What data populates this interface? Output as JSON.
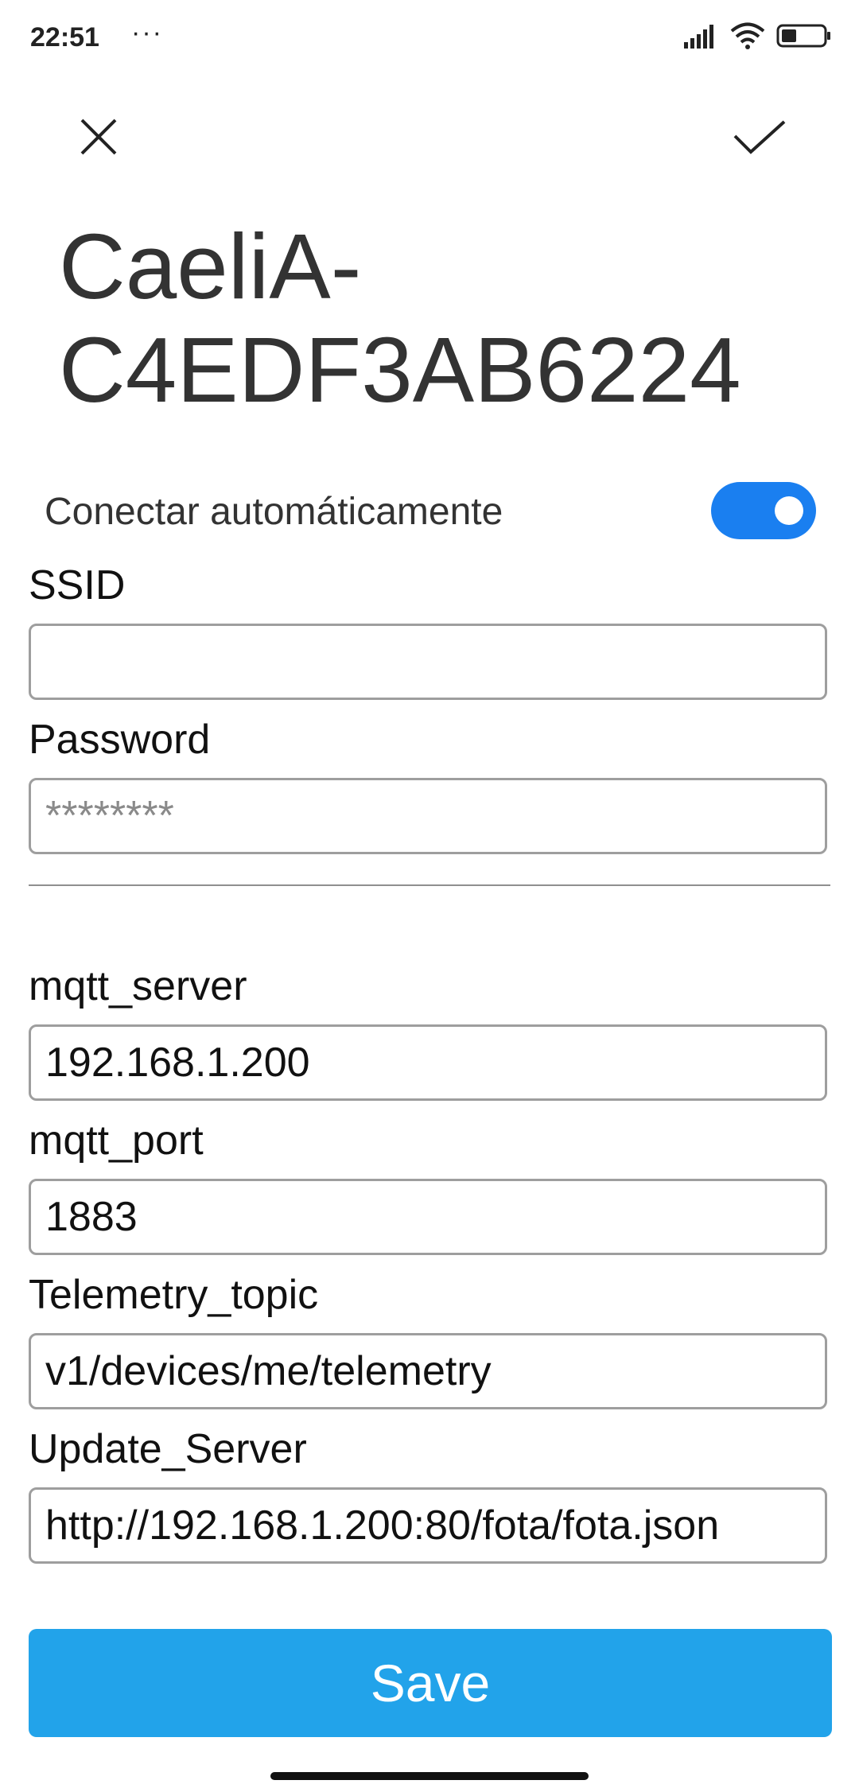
{
  "status_bar": {
    "time": "22:51",
    "notification_dots": "···",
    "icons": [
      "signal-icon",
      "wifi-icon",
      "battery-icon"
    ]
  },
  "top_bar": {
    "close_icon": "close-icon",
    "confirm_icon": "checkmark-icon"
  },
  "network": {
    "title": "CaeliA-C4EDF3AB6224"
  },
  "autoconnect": {
    "label": "Conectar automáticamente",
    "enabled": true,
    "accent": "#1a7ff0"
  },
  "form": {
    "ssid": {
      "label": "SSID",
      "value": "",
      "placeholder": ""
    },
    "password": {
      "label": "Password",
      "value": "",
      "placeholder": "********"
    },
    "mqtt_server": {
      "label": "mqtt_server",
      "value": "192.168.1.200"
    },
    "mqtt_port": {
      "label": "mqtt_port",
      "value": "1883"
    },
    "telemetry_topic": {
      "label": "Telemetry_topic",
      "value": "v1/devices/me/telemetry"
    },
    "update_server": {
      "label": "Update_Server",
      "value": "http://192.168.1.200:80/fota/fota.json"
    }
  },
  "save": {
    "label": "Save",
    "color": "#22a3ea"
  }
}
